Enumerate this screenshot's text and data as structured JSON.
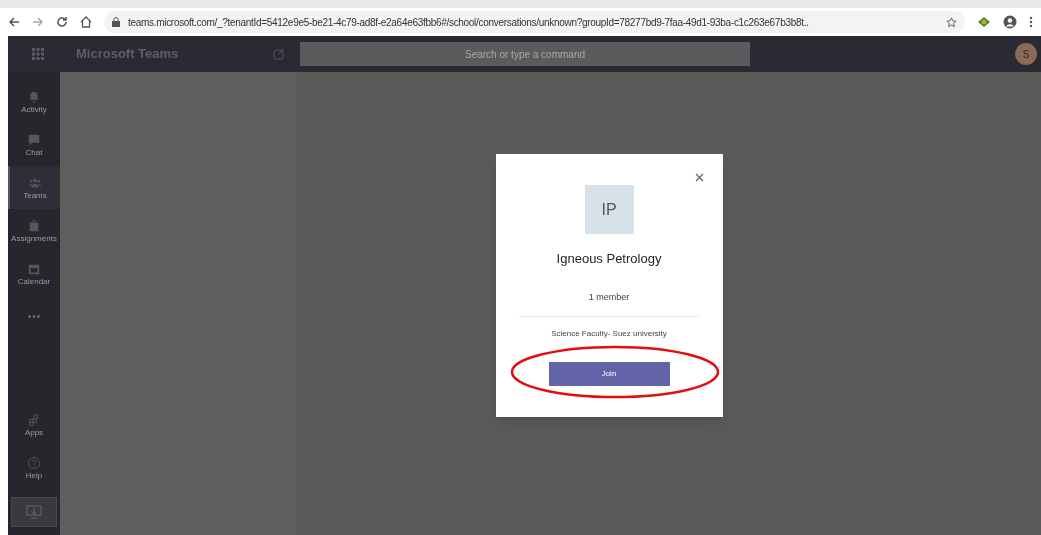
{
  "browser": {
    "url": "teams.microsoft.com/_?tenantId=5412e9e5-be21-4c79-ad8f-e2a64e63fbb6#/school/conversations/unknown?groupId=78277bd9-7faa-49d1-93ba-c1c263e67b3b8t.."
  },
  "header": {
    "title": "Microsoft Teams",
    "search": {
      "placeholder": "Search or type a command"
    },
    "avatar": "S"
  },
  "rail": [
    {
      "label": "Activity",
      "selected": false
    },
    {
      "label": "Chat",
      "selected": false
    },
    {
      "label": "Teams",
      "selected": true
    },
    {
      "label": "Assignments",
      "selected": false
    },
    {
      "label": "Calendar",
      "selected": false
    },
    {
      "selected": false
    }
  ],
  "rail_bottom": [
    {
      "label": "Apps"
    },
    {
      "label": "Help"
    }
  ],
  "dialog": {
    "initials": "IP",
    "name": "Igneous Petrology",
    "members": "1 member",
    "description": "Science Faculty- Suez university",
    "join": "Join",
    "highlighted": true
  }
}
